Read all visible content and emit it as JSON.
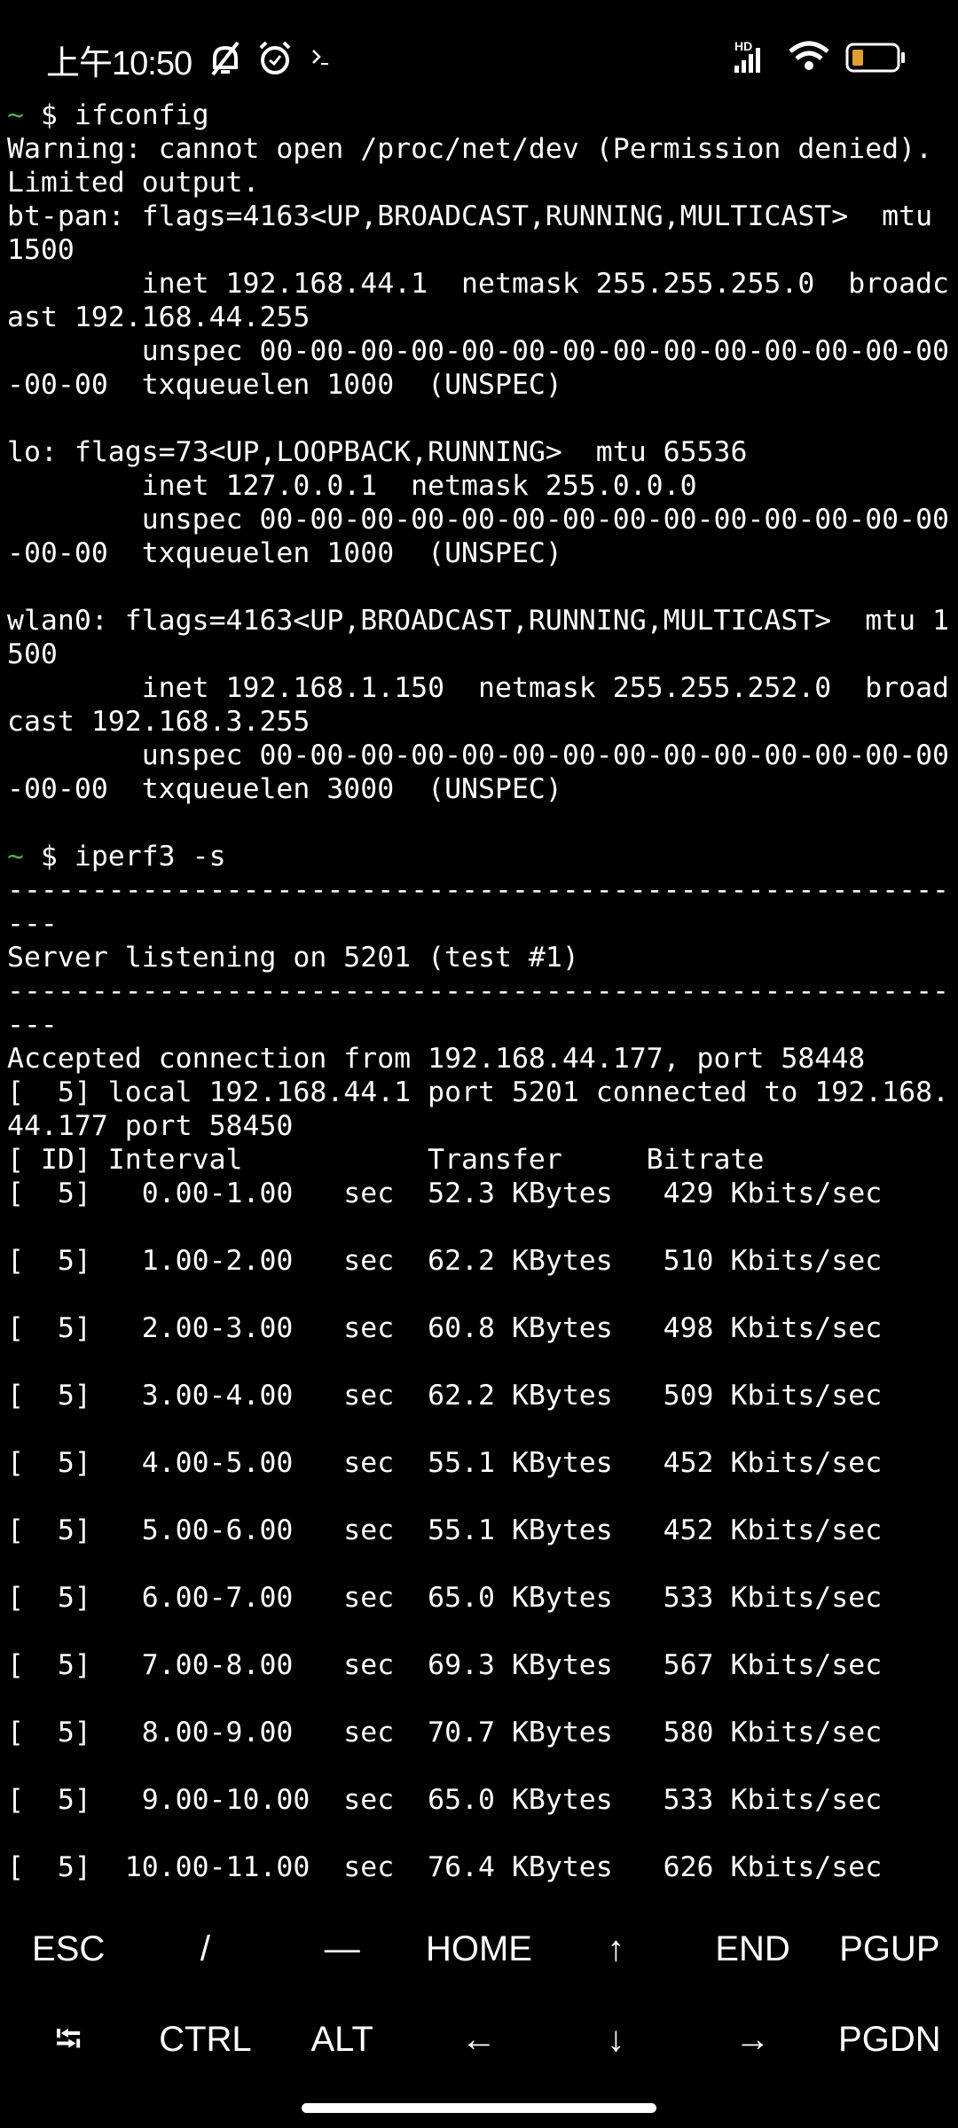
{
  "status_bar": {
    "time": "上午10:50",
    "icons": [
      "bell-off-icon",
      "alarm-icon",
      "terminal-icon",
      "hd-signal-icon",
      "wifi-icon",
      "battery-icon"
    ],
    "signal_label": "HD",
    "battery_color": "#e0a030",
    "battery_level": 0.2
  },
  "prompt_color": "#4caf50",
  "terminal": {
    "lines": [
      {
        "prompt": "~",
        "text": " $ ifconfig"
      },
      {
        "text": "Warning: cannot open /proc/net/dev (Permission denied)."
      },
      {
        "text": "Limited output."
      },
      {
        "text": "bt-pan: flags=4163<UP,BROADCAST,RUNNING,MULTICAST>  mtu"
      },
      {
        "text": "1500"
      },
      {
        "text": "        inet 192.168.44.1  netmask 255.255.255.0  broadc"
      },
      {
        "text": "ast 192.168.44.255"
      },
      {
        "text": "        unspec 00-00-00-00-00-00-00-00-00-00-00-00-00-00"
      },
      {
        "text": "-00-00  txqueuelen 1000  (UNSPEC)"
      },
      {
        "text": ""
      },
      {
        "text": "lo: flags=73<UP,LOOPBACK,RUNNING>  mtu 65536"
      },
      {
        "text": "        inet 127.0.0.1  netmask 255.0.0.0"
      },
      {
        "text": "        unspec 00-00-00-00-00-00-00-00-00-00-00-00-00-00"
      },
      {
        "text": "-00-00  txqueuelen 1000  (UNSPEC)"
      },
      {
        "text": ""
      },
      {
        "text": "wlan0: flags=4163<UP,BROADCAST,RUNNING,MULTICAST>  mtu 1"
      },
      {
        "text": "500"
      },
      {
        "text": "        inet 192.168.1.150  netmask 255.255.252.0  broad"
      },
      {
        "text": "cast 192.168.3.255"
      },
      {
        "text": "        unspec 00-00-00-00-00-00-00-00-00-00-00-00-00-00"
      },
      {
        "text": "-00-00  txqueuelen 3000  (UNSPEC)"
      },
      {
        "text": ""
      },
      {
        "prompt": "~",
        "text": " $ iperf3 -s"
      },
      {
        "text": "--------------------------------------------------------"
      },
      {
        "text": "---"
      },
      {
        "text": "Server listening on 5201 (test #1)"
      },
      {
        "text": "--------------------------------------------------------"
      },
      {
        "text": "---"
      },
      {
        "text": "Accepted connection from 192.168.44.177, port 58448"
      },
      {
        "text": "[  5] local 192.168.44.1 port 5201 connected to 192.168."
      },
      {
        "text": "44.177 port 58450"
      },
      {
        "text": "[ ID] Interval           Transfer     Bitrate"
      },
      {
        "text": "[  5]   0.00-1.00   sec  52.3 KBytes   429 Kbits/sec"
      },
      {
        "text": ""
      },
      {
        "text": "[  5]   1.00-2.00   sec  62.2 KBytes   510 Kbits/sec"
      },
      {
        "text": ""
      },
      {
        "text": "[  5]   2.00-3.00   sec  60.8 KBytes   498 Kbits/sec"
      },
      {
        "text": ""
      },
      {
        "text": "[  5]   3.00-4.00   sec  62.2 KBytes   509 Kbits/sec"
      },
      {
        "text": ""
      },
      {
        "text": "[  5]   4.00-5.00   sec  55.1 KBytes   452 Kbits/sec"
      },
      {
        "text": ""
      },
      {
        "text": "[  5]   5.00-6.00   sec  55.1 KBytes   452 Kbits/sec"
      },
      {
        "text": ""
      },
      {
        "text": "[  5]   6.00-7.00   sec  65.0 KBytes   533 Kbits/sec"
      },
      {
        "text": ""
      },
      {
        "text": "[  5]   7.00-8.00   sec  69.3 KBytes   567 Kbits/sec"
      },
      {
        "text": ""
      },
      {
        "text": "[  5]   8.00-9.00   sec  70.7 KBytes   580 Kbits/sec"
      },
      {
        "text": ""
      },
      {
        "text": "[  5]   9.00-10.00  sec  65.0 KBytes   533 Kbits/sec"
      },
      {
        "text": ""
      },
      {
        "text": "[  5]  10.00-11.00  sec  76.4 KBytes   626 Kbits/sec"
      }
    ]
  },
  "extra_keys": {
    "row1": [
      "ESC",
      "/",
      "—",
      "HOME",
      "↑",
      "END",
      "PGUP"
    ],
    "row2": [
      "⭾",
      "CTRL",
      "ALT",
      "←",
      "↓",
      "→",
      "PGDN"
    ]
  }
}
